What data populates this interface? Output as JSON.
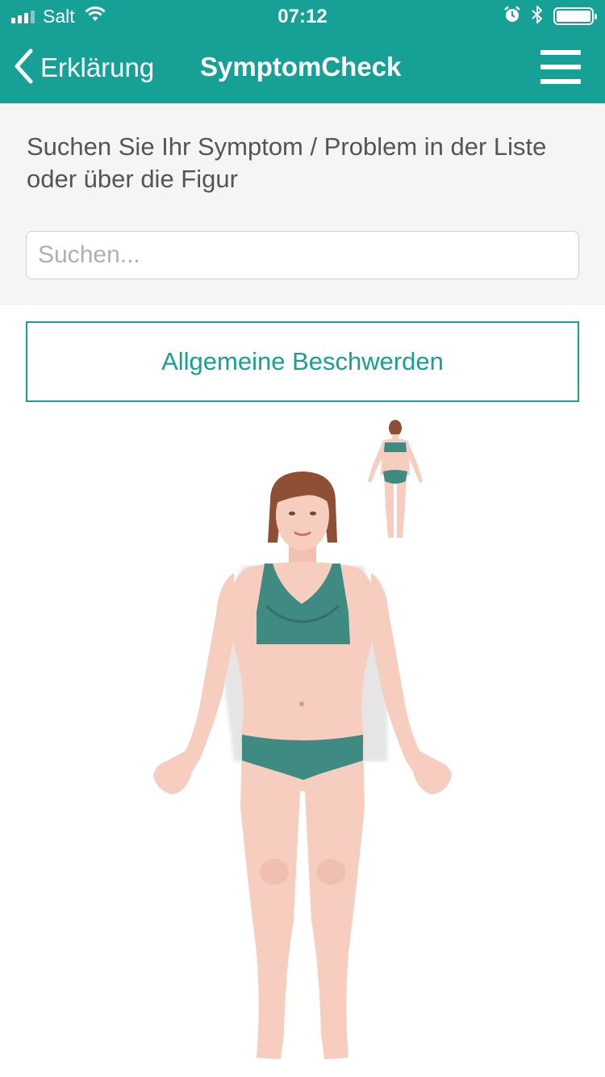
{
  "status_bar": {
    "carrier": "Salt",
    "time": "07:12",
    "battery_level": 1.0
  },
  "nav": {
    "back_label": "Erklärung",
    "title": "SymptomCheck"
  },
  "search_section": {
    "instruction": "Suchen Sie Ihr Symptom / Problem in der Liste oder über die Figur",
    "search_placeholder": "Suchen..."
  },
  "general_button_label": "Allgemeine Beschwerden",
  "colors": {
    "brand": "#17a096",
    "skin": "#f6cdbf",
    "clothing": "#3f8a82",
    "hair": "#8e4f35"
  },
  "icons": [
    "signal-icon",
    "wifi-icon",
    "alarm-icon",
    "bluetooth-icon",
    "battery-icon",
    "back-chevron-icon",
    "hamburger-menu-icon"
  ]
}
